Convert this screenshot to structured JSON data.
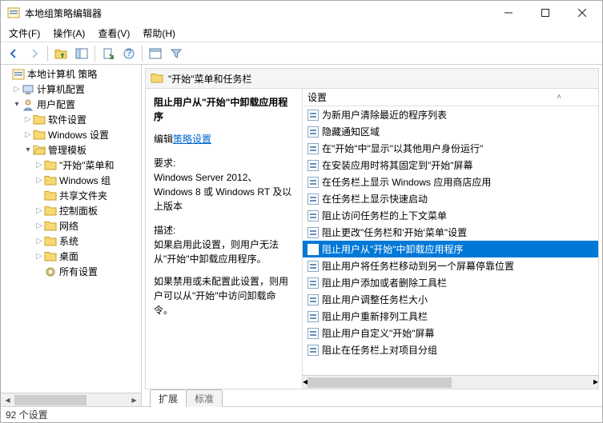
{
  "window": {
    "title": "本地组策略编辑器"
  },
  "menu": {
    "file": "文件(F)",
    "action": "操作(A)",
    "view": "查看(V)",
    "help": "帮助(H)"
  },
  "tree": {
    "root": "本地计算机 策略",
    "computer_config": "计算机配置",
    "user_config": "用户配置",
    "software_settings": "软件设置",
    "windows_settings": "Windows 设置",
    "admin_templates": "管理模板",
    "start_taskbar": "\"开始\"菜单和",
    "windows_components": "Windows 组",
    "shared_folders": "共享文件夹",
    "control_panel": "控制面板",
    "network": "网络",
    "system": "系统",
    "desktop": "桌面",
    "all_settings": "所有设置"
  },
  "section": {
    "title": "\"开始\"菜单和任务栏"
  },
  "info": {
    "selected_title": "阻止用户从\"开始\"中卸载应用程序",
    "edit": "编辑",
    "edit_link": "策略设置",
    "req_label": "要求:",
    "req_text": "Windows Server 2012、Windows 8 或 Windows RT 及以上版本",
    "desc_label": "描述:",
    "desc_p1": "如果启用此设置，则用户无法从\"开始\"中卸载应用程序。",
    "desc_p2": "如果禁用或未配置此设置，则用户可以从\"开始\"中访问卸载命令。"
  },
  "settings": {
    "header": "设置",
    "items": [
      "为新用户清除最近的程序列表",
      "隐藏通知区域",
      "在\"开始\"中\"显示\"以其他用户身份运行\"",
      "在安装应用时将其固定到\"开始\"屏幕",
      "在任务栏上显示 Windows 应用商店应用",
      "在任务栏上显示快速启动",
      "阻止访问任务栏的上下文菜单",
      "阻止更改\"任务栏和'开始'菜单\"设置",
      "阻止用户从\"开始\"中卸载应用程序",
      "阻止用户将任务栏移动到另一个屏幕停靠位置",
      "阻止用户添加或者删除工具栏",
      "阻止用户调整任务栏大小",
      "阻止用户重新排列工具栏",
      "阻止用户自定义\"开始\"屏幕",
      "阻止在任务栏上对项目分组"
    ],
    "selected_index": 8
  },
  "tabs": {
    "extended": "扩展",
    "standard": "标准"
  },
  "status": {
    "text": "92 个设置"
  }
}
